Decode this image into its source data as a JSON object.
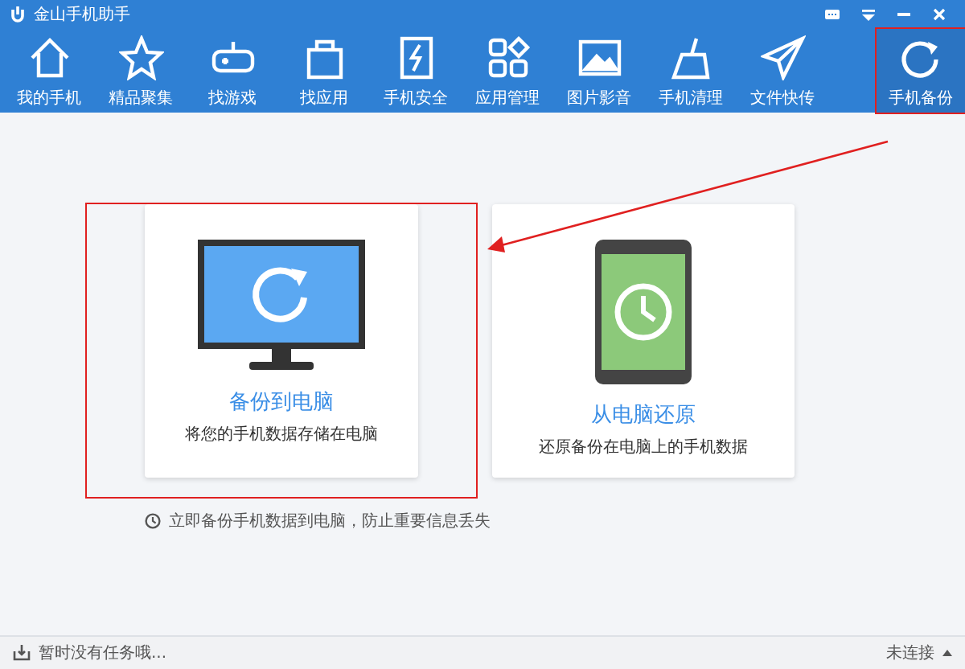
{
  "window": {
    "title": "金山手机助手"
  },
  "toolbar": [
    {
      "label": "我的手机",
      "selected": false,
      "annotated": false
    },
    {
      "label": "精品聚集",
      "selected": false,
      "annotated": false
    },
    {
      "label": "找游戏",
      "selected": false,
      "annotated": false
    },
    {
      "label": "找应用",
      "selected": false,
      "annotated": false
    },
    {
      "label": "手机安全",
      "selected": false,
      "annotated": false
    },
    {
      "label": "应用管理",
      "selected": false,
      "annotated": false
    },
    {
      "label": "图片影音",
      "selected": false,
      "annotated": false
    },
    {
      "label": "手机清理",
      "selected": false,
      "annotated": false
    },
    {
      "label": "文件快传",
      "selected": false,
      "annotated": false
    },
    {
      "label": "手机备份",
      "selected": true,
      "annotated": true
    }
  ],
  "cards": [
    {
      "title": "备份到电脑",
      "subtitle": "将您的手机数据存储在电脑",
      "annotated": true
    },
    {
      "title": "从电脑还原",
      "subtitle": "还原备份在电脑上的手机数据",
      "annotated": false
    }
  ],
  "tip": "立即备份手机数据到电脑，防止重要信息丢失",
  "status_bar": {
    "message": "暂时没有任务哦...",
    "connection": "未连接"
  }
}
